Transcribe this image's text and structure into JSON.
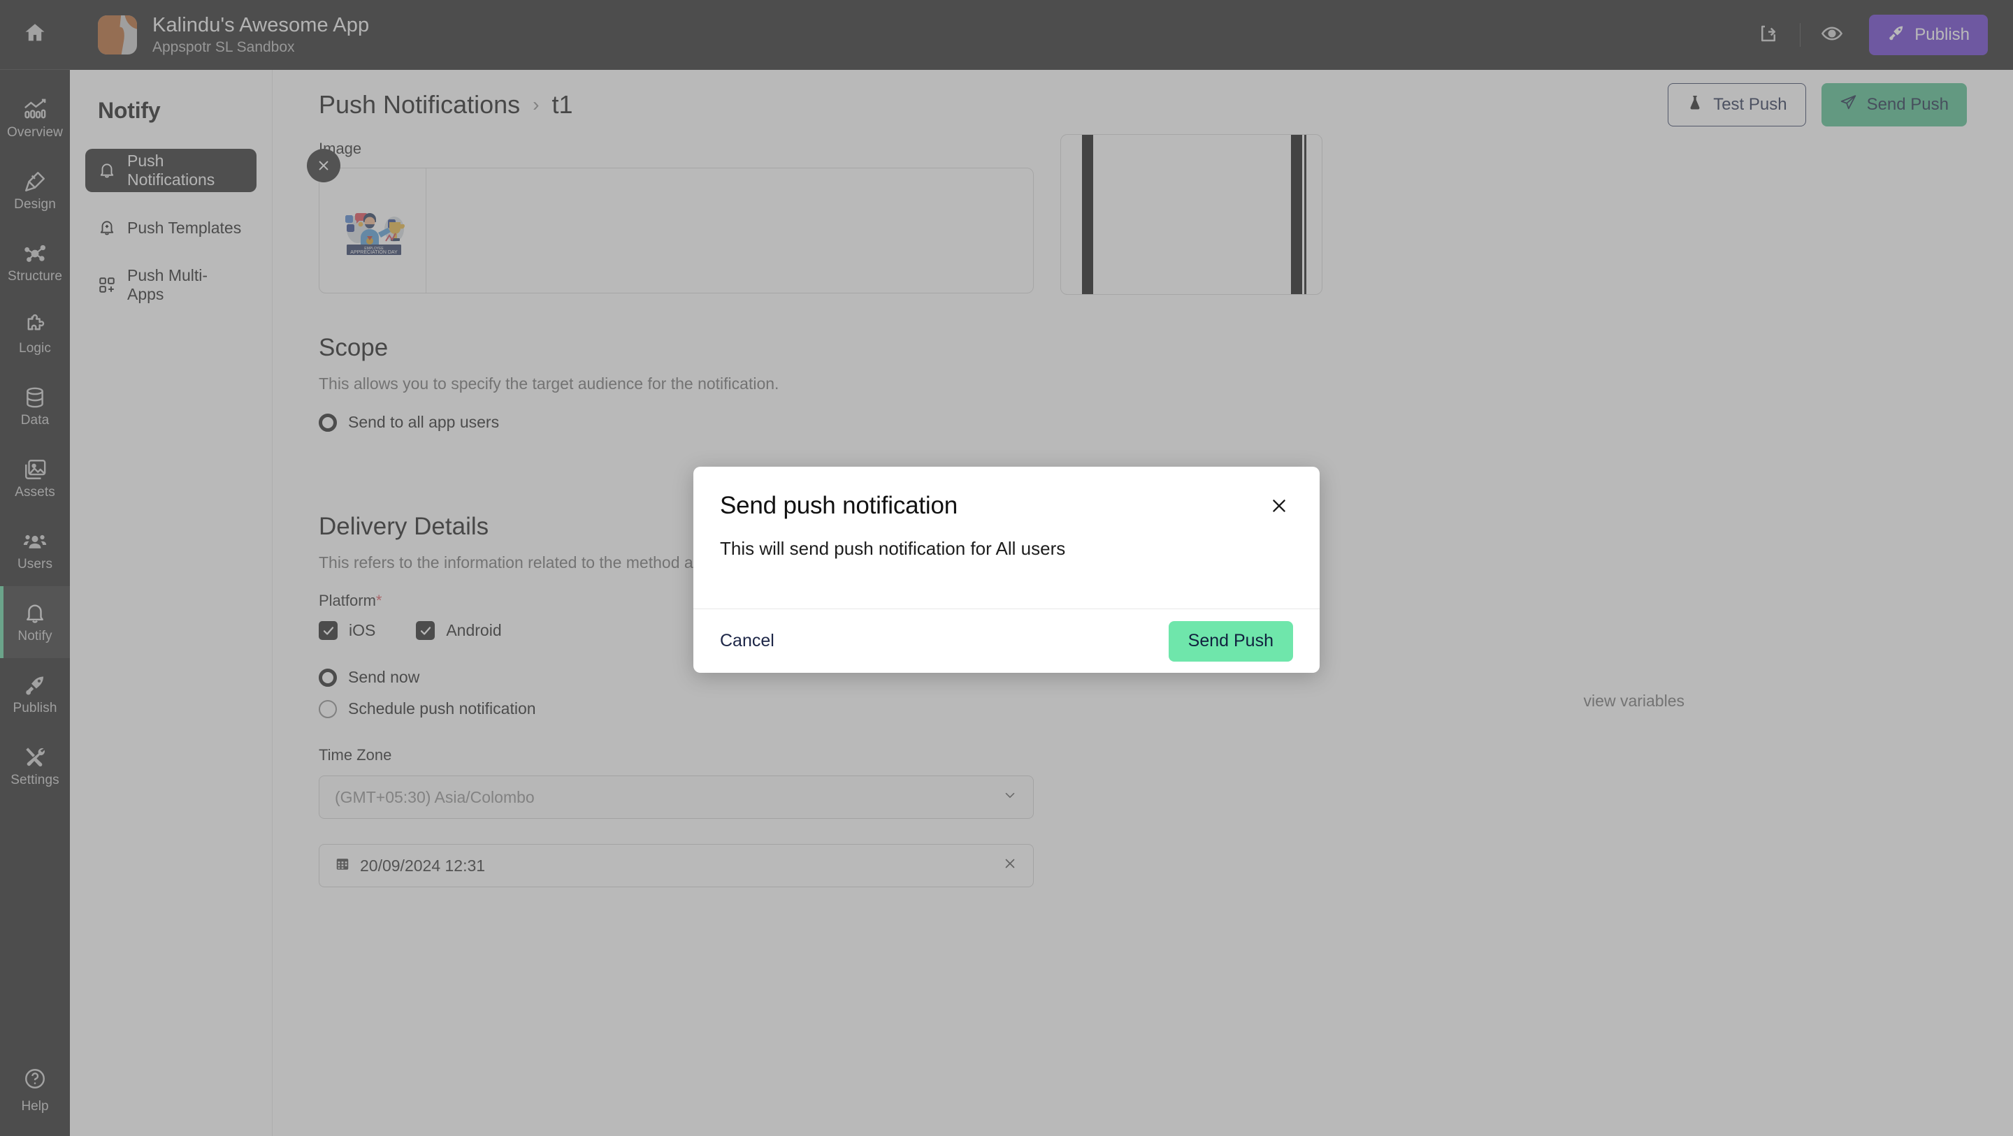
{
  "rail": {
    "home_icon": "home-icon",
    "items": [
      {
        "label": "Overview",
        "icon": "analytics-icon"
      },
      {
        "label": "Design",
        "icon": "pencil-ruler-icon"
      },
      {
        "label": "Structure",
        "icon": "structure-nodes-icon"
      },
      {
        "label": "Logic",
        "icon": "puzzle-icon"
      },
      {
        "label": "Data",
        "icon": "database-icon"
      },
      {
        "label": "Assets",
        "icon": "image-stack-icon"
      },
      {
        "label": "Users",
        "icon": "people-icon"
      },
      {
        "label": "Notify",
        "icon": "bell-icon"
      },
      {
        "label": "Publish",
        "icon": "rocket-icon"
      },
      {
        "label": "Settings",
        "icon": "tools-icon"
      }
    ],
    "active_label": "Notify",
    "help": {
      "label": "Help",
      "icon": "question-circle-icon"
    },
    "active_accent": "#5dd39e"
  },
  "topbar": {
    "app_title": "Kalindu's Awesome App",
    "app_subtitle": "Appspotr SL Sandbox",
    "share_icon": "share-icon",
    "preview_icon": "eye-icon",
    "publish_label": "Publish",
    "publish_icon": "rocket-icon",
    "publish_color": "#6236cd"
  },
  "subnav": {
    "title": "Notify",
    "items": [
      {
        "label": "Push Notifications",
        "icon": "bell-icon",
        "active": true
      },
      {
        "label": "Push Templates",
        "icon": "bell-plus-icon",
        "active": false
      },
      {
        "label": "Push Multi-Apps",
        "icon": "grid-plus-icon",
        "active": false
      }
    ]
  },
  "page": {
    "breadcrumb_parent": "Push Notifications",
    "breadcrumb_sep": "›",
    "breadcrumb_current": "t1",
    "test_push_label": "Test Push",
    "test_push_icon": "flask-icon",
    "send_push_label": "Send Push",
    "send_push_icon": "paper-plane-icon",
    "send_push_color": "#4cbd8a"
  },
  "form": {
    "image_label": "Image",
    "image_remove_icon": "close-icon",
    "image_alt_text": "Employee Appreciation Day illustration",
    "scope": {
      "title": "Scope",
      "description": "This allows you to specify the target audience for the notification.",
      "option_all_users": "Send to all app users"
    },
    "view_variables_text": "view variables",
    "delivery": {
      "title": "Delivery Details",
      "description": "This refers to the information related to the method and timing of delivery for push notifications.",
      "platform_label": "Platform",
      "platform_required_mark": "*",
      "platform_options": [
        {
          "label": "iOS",
          "checked": true
        },
        {
          "label": "Android",
          "checked": true
        }
      ],
      "send_now_label": "Send now",
      "send_now_selected": true,
      "schedule_label": "Schedule push notification",
      "schedule_selected": false,
      "timezone_label": "Time Zone",
      "timezone_value": "(GMT+05:30) Asia/Colombo",
      "timezone_caret_icon": "chevron-down-icon",
      "date_icon": "calendar-icon",
      "date_value": "20/09/2024 12:31",
      "date_clear_icon": "close-icon"
    }
  },
  "modal": {
    "title": "Send push notification",
    "close_icon": "close-icon",
    "body_text": "This will send push notification for All users",
    "cancel_label": "Cancel",
    "send_label": "Send Push",
    "send_color": "#6fe6ab"
  }
}
